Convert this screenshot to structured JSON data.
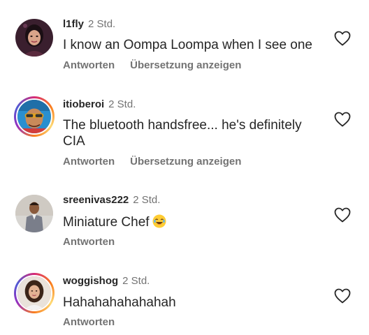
{
  "comments": [
    {
      "username": "l1fly",
      "time": "2 Std.",
      "text": "I know an Oompa Loompa when I see one",
      "actions": [
        "Antworten",
        "Übersetzung anzeigen"
      ]
    },
    {
      "username": "itioberoi",
      "time": "2 Std.",
      "text": "The bluetooth handsfree... he's definitely CIA",
      "actions": [
        "Antworten",
        "Übersetzung anzeigen"
      ]
    },
    {
      "username": "sreenivas222",
      "time": "2 Std.",
      "text": "Miniature Chef",
      "emoji": "laughing-emoji",
      "actions": [
        "Antworten"
      ]
    },
    {
      "username": "woggishog",
      "time": "2 Std.",
      "text": "Hahahahahahahah",
      "actions": [
        "Antworten"
      ]
    }
  ],
  "colors": {
    "text": "#262626",
    "secondary": "#737373",
    "story_ring": "#d62976"
  },
  "icons": {
    "like": "heart-outline-icon"
  }
}
